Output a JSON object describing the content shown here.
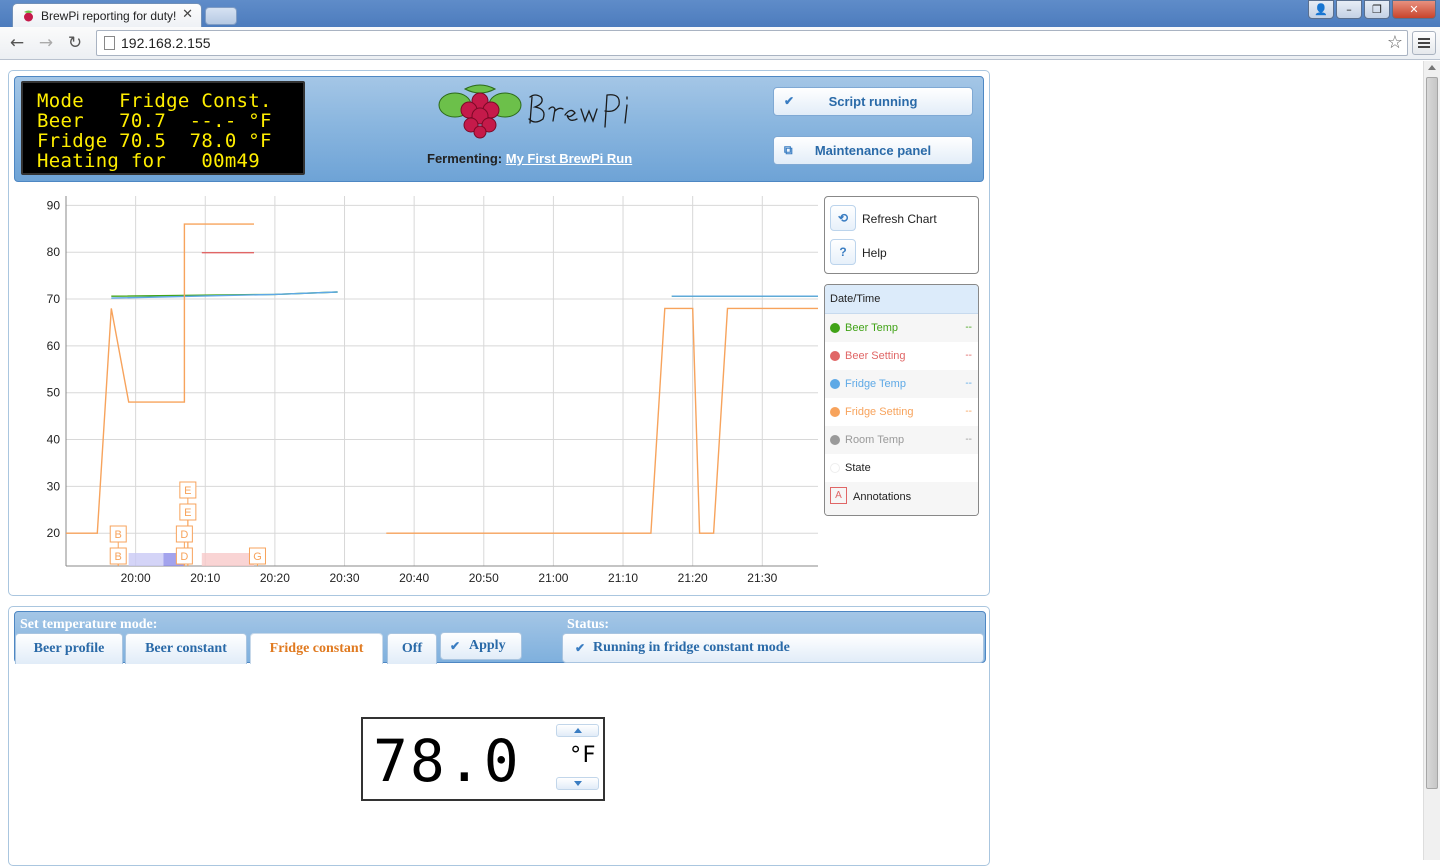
{
  "browser": {
    "tab_title": "BrewPi reporting for duty!",
    "url": "192.168.2.155"
  },
  "lcd": {
    "lines": [
      "Mode   Fridge Const.",
      "Beer   70.7  --.- °F",
      "Fridge 70.5  78.0 °F",
      "Heating for   00m49"
    ]
  },
  "header": {
    "fermenting_label": "Fermenting:",
    "beer_name": "My First BrewPi Run",
    "script_button": "Script running",
    "maintenance_button": "Maintenance panel"
  },
  "chart_controls": {
    "refresh": "Refresh Chart",
    "help": "Help",
    "help_icon_text": "?"
  },
  "legend": {
    "header": "Date/Time",
    "rows": [
      {
        "name": "Beer Temp",
        "value": "--",
        "color": "#41a317"
      },
      {
        "name": "Beer Setting",
        "value": "--",
        "color": "#e06666"
      },
      {
        "name": "Fridge Temp",
        "value": "--",
        "color": "#5ea9e6"
      },
      {
        "name": "Fridge Setting",
        "value": "--",
        "color": "#f7a35c"
      },
      {
        "name": "Room Temp",
        "value": "--",
        "color": "#9a9a9a"
      },
      {
        "name": "State",
        "value": "",
        "color": "#ffffff"
      }
    ],
    "annotations_label": "Annotations",
    "annotations_icon_text": "A"
  },
  "chart_data": {
    "type": "line",
    "y_ticks": [
      20,
      30,
      40,
      50,
      60,
      70,
      80,
      90
    ],
    "x_ticks": [
      "20:00",
      "20:10",
      "20:20",
      "20:30",
      "20:40",
      "20:50",
      "21:00",
      "21:10",
      "21:20",
      "21:30"
    ],
    "ylim": [
      13,
      92
    ],
    "xlim_minutes": [
      -10,
      98
    ],
    "grid": true,
    "series": [
      {
        "name": "Beer Temp",
        "color": "#41a317",
        "points": [
          [
            -3.5,
            70.6
          ],
          [
            20,
            71.0
          ],
          [
            29,
            71.5
          ],
          null,
          [
            77,
            70.6
          ],
          [
            85,
            70.6
          ],
          [
            98,
            70.6
          ]
        ]
      },
      {
        "name": "Fridge Temp",
        "color": "#5ea9e6",
        "points": [
          [
            -3.5,
            70.2
          ],
          [
            20,
            71.0
          ],
          [
            29,
            71.5
          ],
          null,
          [
            77,
            70.6
          ],
          [
            85,
            70.6
          ],
          [
            98,
            70.6
          ]
        ]
      },
      {
        "name": "Beer Setting",
        "color": "#e06666",
        "points": [
          [
            9.5,
            79.9
          ],
          [
            17,
            79.9
          ]
        ]
      },
      {
        "name": "Fridge Setting",
        "color": "#f7a35c",
        "points": [
          [
            -10,
            20
          ],
          [
            -5.5,
            20
          ],
          [
            -3.5,
            68
          ],
          [
            -1,
            48
          ],
          [
            7,
            48
          ],
          [
            7,
            86
          ],
          [
            17,
            86
          ],
          null,
          [
            36,
            20
          ],
          [
            74,
            20
          ],
          [
            76,
            68
          ],
          [
            80,
            68
          ],
          [
            81,
            20
          ],
          [
            83,
            20
          ],
          [
            85,
            68
          ],
          [
            98,
            68
          ]
        ]
      }
    ],
    "state_bands": [
      {
        "from": -1,
        "to": 4,
        "color": "#c9c9f5"
      },
      {
        "from": 4,
        "to": 7,
        "color": "#8c8ce8"
      },
      {
        "from": 9.5,
        "to": 17,
        "color": "#f8c9c9"
      }
    ],
    "annotations": [
      {
        "label": "B",
        "x": -2.5,
        "row": 1
      },
      {
        "label": "B",
        "x": -2.5,
        "row": 0
      },
      {
        "label": "E",
        "x": 7.5,
        "row": 3
      },
      {
        "label": "E",
        "x": 7.5,
        "row": 2
      },
      {
        "label": "D",
        "x": 7,
        "row": 1
      },
      {
        "label": "D",
        "x": 7,
        "row": 0
      },
      {
        "label": "G",
        "x": 17.5,
        "row": 0
      }
    ]
  },
  "mode": {
    "title": "Set temperature mode:",
    "tabs": [
      "Beer profile",
      "Beer constant",
      "Fridge constant",
      "Off"
    ],
    "active_tab": "Fridge constant",
    "apply": "Apply"
  },
  "status": {
    "title": "Status:",
    "text": "Running in fridge constant mode"
  },
  "setpoint": {
    "value": "78.0",
    "unit": "°F"
  }
}
